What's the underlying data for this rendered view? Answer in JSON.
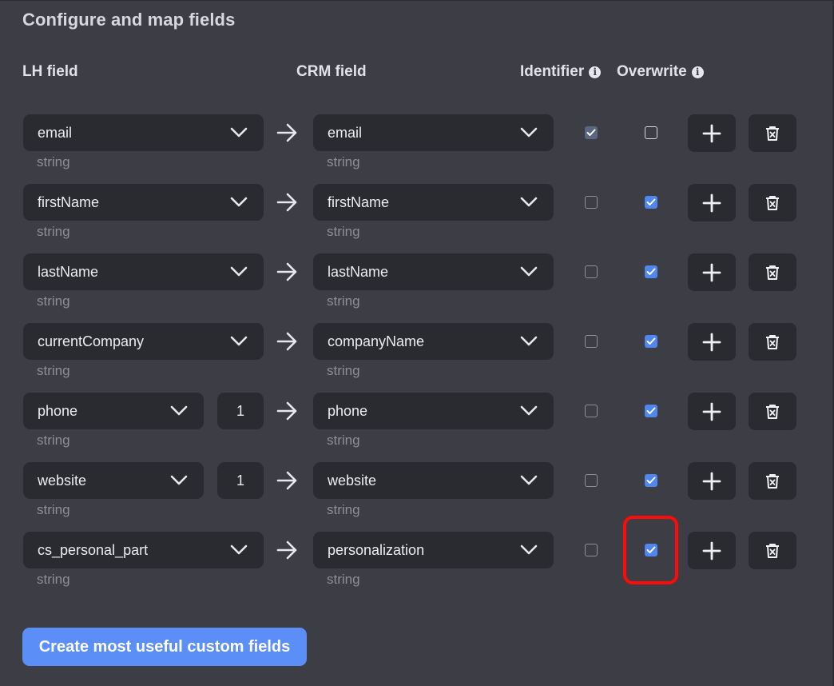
{
  "title": "Configure and map fields",
  "headers": {
    "lh_field": "LH field",
    "crm_field": "CRM field",
    "identifier": "Identifier",
    "overwrite": "Overwrite",
    "info_glyph": "i"
  },
  "rows": [
    {
      "lh_field": "email",
      "lh_type": "string",
      "index": "",
      "crm_field": "email",
      "crm_type": "string",
      "identifier": "checked-disabled",
      "overwrite": false
    },
    {
      "lh_field": "firstName",
      "lh_type": "string",
      "index": "",
      "crm_field": "firstName",
      "crm_type": "string",
      "identifier": false,
      "overwrite": true
    },
    {
      "lh_field": "lastName",
      "lh_type": "string",
      "index": "",
      "crm_field": "lastName",
      "crm_type": "string",
      "identifier": false,
      "overwrite": true
    },
    {
      "lh_field": "currentCompany",
      "lh_type": "string",
      "index": "",
      "crm_field": "companyName",
      "crm_type": "string",
      "identifier": false,
      "overwrite": true
    },
    {
      "lh_field": "phone",
      "lh_type": "string",
      "index": "1",
      "crm_field": "phone",
      "crm_type": "string",
      "identifier": false,
      "overwrite": true
    },
    {
      "lh_field": "website",
      "lh_type": "string",
      "index": "1",
      "crm_field": "website",
      "crm_type": "string",
      "identifier": false,
      "overwrite": true
    },
    {
      "lh_field": "cs_personal_part",
      "lh_type": "string",
      "index": "",
      "crm_field": "personalization",
      "crm_type": "string",
      "identifier": false,
      "overwrite": true
    }
  ],
  "icons": {
    "dropdown": "chevron-down-icon",
    "map_arrow": "arrow-right-icon",
    "add": "plus-icon",
    "delete": "trash-icon",
    "info": "info-icon",
    "check": "checkmark-icon"
  },
  "create_button_label": "Create most useful custom fields",
  "colors": {
    "background": "#3c3d45",
    "control": "#2a2b31",
    "accent": "#5b8ff7",
    "checkbox_checked": "#4f86f0",
    "highlight": "#ff0a0a",
    "muted_text": "#8d8e96"
  }
}
